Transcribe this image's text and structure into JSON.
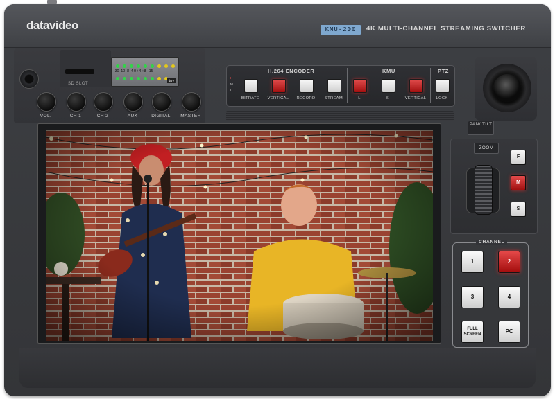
{
  "brand": "datavideo",
  "model": {
    "badge": "KMU-200",
    "title": "4K MULTI-CHANNEL STREAMING SWITCHER"
  },
  "sd_slot": {
    "label": "SD SLOT"
  },
  "meter": {
    "scale": "-30 -10 -8 -4 0 +4 +8 +15",
    "logo": "dBV"
  },
  "audio_knobs": [
    "VOL.",
    "CH 1",
    "CH 2",
    "AUX",
    "DIGITAL",
    "MASTER"
  ],
  "encoder": {
    "title": "H.264 ENCODER",
    "levels": [
      "H",
      "M",
      "L"
    ],
    "buttons": [
      {
        "label": "BITRATE",
        "active": false
      },
      {
        "label": "VERTICAL",
        "active": true
      },
      {
        "label": "RECORD",
        "active": false
      },
      {
        "label": "STREAM",
        "active": false
      }
    ]
  },
  "kmu": {
    "title": "KMU",
    "buttons": [
      {
        "label": "L",
        "active": true
      },
      {
        "label": "S",
        "active": false
      },
      {
        "label": "VERTICAL",
        "active": true
      }
    ]
  },
  "ptz": {
    "title": "PTZ",
    "lock_label": "LOCK",
    "pan_tilt": "PAN/ TILT",
    "zoom": "ZOOM"
  },
  "speed_buttons": [
    {
      "label": "F",
      "active": false
    },
    {
      "label": "M",
      "active": true
    },
    {
      "label": "S",
      "active": false
    }
  ],
  "channel": {
    "title": "CHANNEL",
    "buttons": [
      {
        "label": "1",
        "active": false
      },
      {
        "label": "2",
        "active": true
      },
      {
        "label": "3",
        "active": false
      },
      {
        "label": "4",
        "active": false
      },
      {
        "label": "FULL SCREEN",
        "active": false
      },
      {
        "label": "PC",
        "active": false
      }
    ]
  },
  "colors": {
    "body": "#3c3e42",
    "active_red": "#c81e1e",
    "model_badge": "#7fa8cf",
    "brick": "#8a3a28"
  }
}
